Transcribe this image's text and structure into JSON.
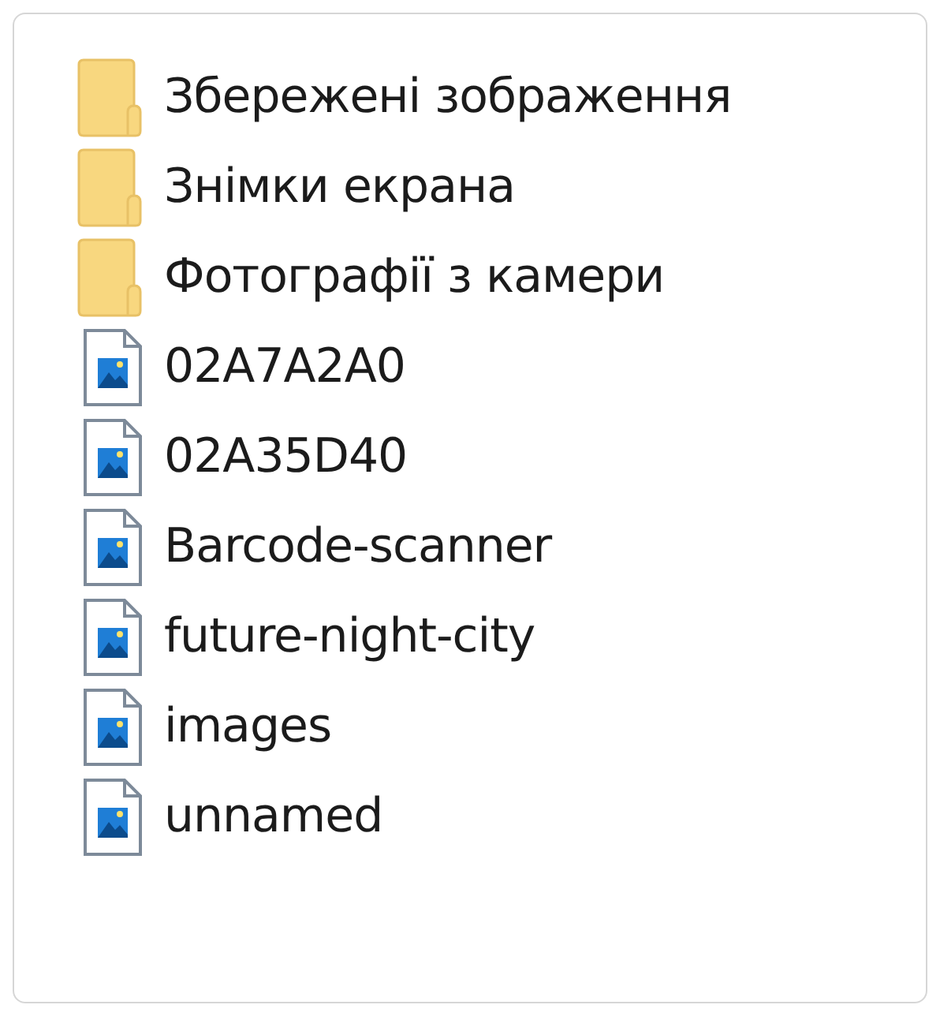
{
  "items": [
    {
      "kind": "folder",
      "name": "Збережені зображення"
    },
    {
      "kind": "folder",
      "name": "Знімки екрана"
    },
    {
      "kind": "folder",
      "name": "Фотографії з камери"
    },
    {
      "kind": "image",
      "name": "02A7A2A0"
    },
    {
      "kind": "image",
      "name": "02A35D40"
    },
    {
      "kind": "image",
      "name": "Barcode-scanner"
    },
    {
      "kind": "image",
      "name": "future-night-city"
    },
    {
      "kind": "image",
      "name": "images"
    },
    {
      "kind": "image",
      "name": "unnamed"
    }
  ]
}
